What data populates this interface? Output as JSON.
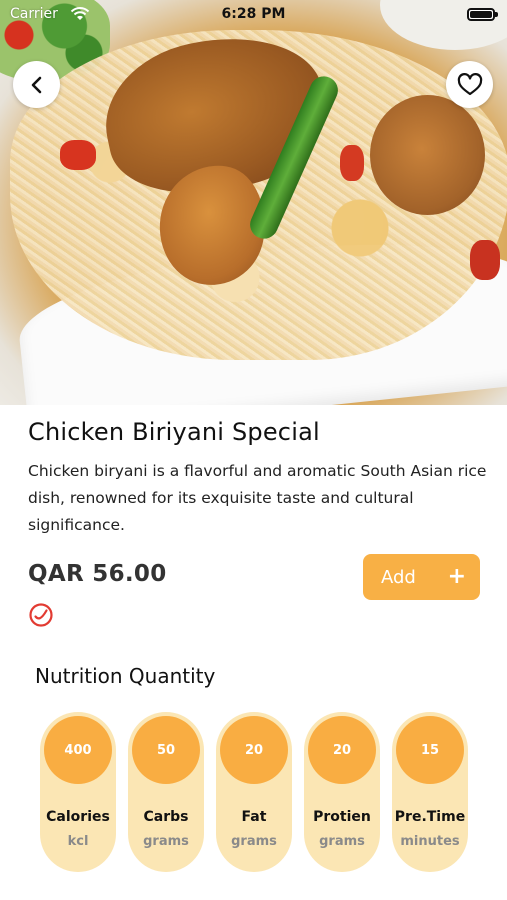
{
  "status_bar": {
    "carrier": "Carrier",
    "time": "6:28 PM"
  },
  "hero": {
    "back_icon": "chevron-left-icon",
    "favorite_icon": "heart-outline-icon"
  },
  "product": {
    "title": "Chicken Biriyani Special",
    "description": "Chicken biryani is a flavorful and aromatic South Asian rice dish, renowned for its exquisite taste and cultural significance.",
    "price": "QAR 56.00",
    "badge_icon": "spicy-check-icon",
    "add_label": "Add",
    "add_icon": "+"
  },
  "nutrition": {
    "title": "Nutrition Quantity",
    "items": [
      {
        "value": "400",
        "label": "Calories",
        "unit": "kcl"
      },
      {
        "value": "50",
        "label": "Carbs",
        "unit": "grams"
      },
      {
        "value": "20",
        "label": "Fat",
        "unit": "grams"
      },
      {
        "value": "20",
        "label": "Protien",
        "unit": "grams"
      },
      {
        "value": "15",
        "label": "Pre.Time",
        "unit": "minutes"
      }
    ]
  },
  "colors": {
    "accent": "#f8b045",
    "card_bg": "#fbe6b4",
    "badge_red": "#e23b32"
  }
}
